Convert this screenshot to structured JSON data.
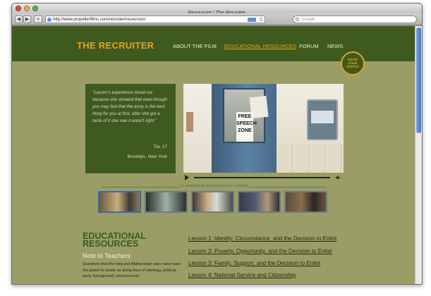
{
  "window": {
    "title": "Resources | The Recruiter",
    "url": "http://www.propellerfilms.com/recruiter/resources/",
    "rss_label": "RSS",
    "reload_glyph": "C",
    "search_placeholder": "Google",
    "nav_back": "◀",
    "nav_forward": "▶",
    "add_bookmark": "+"
  },
  "site": {
    "logo": "THE RECRUITER",
    "nav": [
      {
        "label": "ABOUT THE FILM",
        "active": false
      },
      {
        "label": "EDUCATIONAL RESOURCES",
        "active": true
      },
      {
        "label": "FORUM",
        "active": false
      },
      {
        "label": "NEWS",
        "active": false
      }
    ],
    "badge_text": "KNOW YOUR RIGHTS"
  },
  "quote": {
    "text": "\"Lauren's experience stood out because she showed that even though you may feel that the army is the best thing for you at first, after she got a taste of it she saw it wasn't right.\"",
    "name": "Tia, 17",
    "place": "Brooklyn, New York"
  },
  "video": {
    "sign_text": "FREE SPEECH ZONE"
  },
  "discussion": {
    "label": "CLASSROOM DISCUSSION VIDEOS",
    "thumbnails": 5
  },
  "resources": {
    "title_line1": "EDUCATIONAL",
    "title_line2": "RESOURCES",
    "note_title": "Note to Teachers",
    "note_body": "Questions that the Iraq and Afghanistan wars raise have the power to divide us along lines of ideology, political party, background, and personal",
    "lessons": [
      "Lesson 1: Identity, Circumstance, and the Decision to Enlist",
      "Lesson 2: Poverty, Opportunity, and the Decision to Enlist",
      "Lesson 3: Family, Support, and the Decision to Enlist",
      "Lesson 4: National Service and Citizenship"
    ]
  },
  "colors": {
    "header_green": "#3f5a1f",
    "page_olive": "#9a9e66",
    "accent_gold": "#e2a41c"
  }
}
